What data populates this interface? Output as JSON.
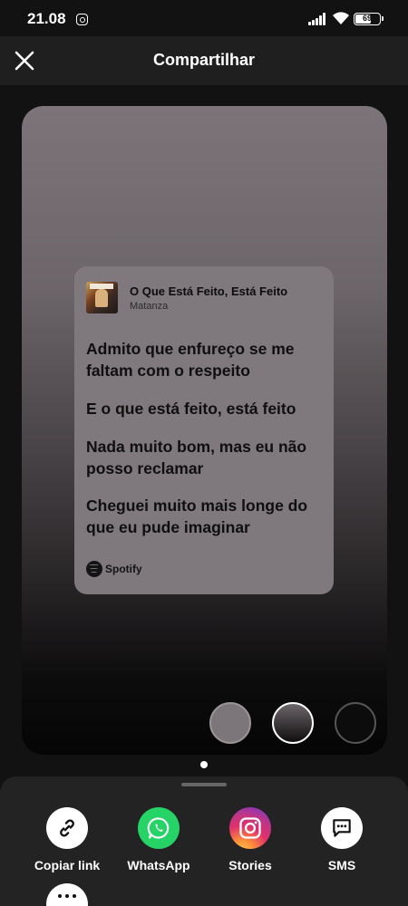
{
  "status_bar": {
    "time": "21.08",
    "battery": "69",
    "icons": [
      "instagram-icon",
      "signal-icon",
      "wifi-icon",
      "battery-icon"
    ]
  },
  "header": {
    "title": "Compartilhar",
    "close_icon": "close-icon"
  },
  "card": {
    "song_title": "O Que Está Feito, Está Feito",
    "artist": "Matanza",
    "lyrics": [
      "Admito que enfureço se me faltam com o respeito",
      "E o que está feito, está feito",
      "Nada muito bom, mas eu não posso reclamar",
      "Cheguei muito mais longe do que eu pude imaginar"
    ],
    "brand": "Spotify",
    "background_color": "#7f787d"
  },
  "background_options": [
    {
      "name": "gray",
      "color": "#7c767a",
      "selected": false
    },
    {
      "name": "gradient",
      "color": "#6d666a",
      "selected": true
    },
    {
      "name": "black",
      "color": "#0c0c0c",
      "selected": false
    }
  ],
  "share_options": [
    {
      "label": "Copiar link",
      "icon": "link-icon"
    },
    {
      "label": "WhatsApp",
      "icon": "whatsapp-icon"
    },
    {
      "label": "Stories",
      "icon": "instagram-icon"
    },
    {
      "label": "SMS",
      "icon": "sms-icon"
    }
  ],
  "more_icon": "more-icon"
}
